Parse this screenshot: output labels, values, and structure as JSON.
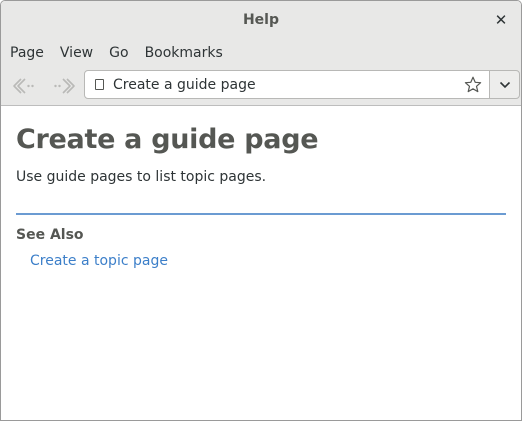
{
  "window": {
    "title": "Help"
  },
  "menubar": {
    "items": [
      "Page",
      "View",
      "Go",
      "Bookmarks"
    ]
  },
  "toolbar": {
    "location_text": "Create a guide page",
    "icons": {
      "back": "back-arrow-icon",
      "forward": "forward-arrow-icon",
      "page": "page-icon",
      "bookmark": "star-icon",
      "dropdown": "chevron-down-icon"
    }
  },
  "content": {
    "title": "Create a guide page",
    "intro": "Use guide pages to list topic pages.",
    "see_also_heading": "See Also",
    "links": [
      "Create a topic page"
    ]
  },
  "colors": {
    "link": "#3c7fc9",
    "divider": "#6b9bd2",
    "heading": "#555753",
    "header_bg": "#e8e8e7"
  }
}
